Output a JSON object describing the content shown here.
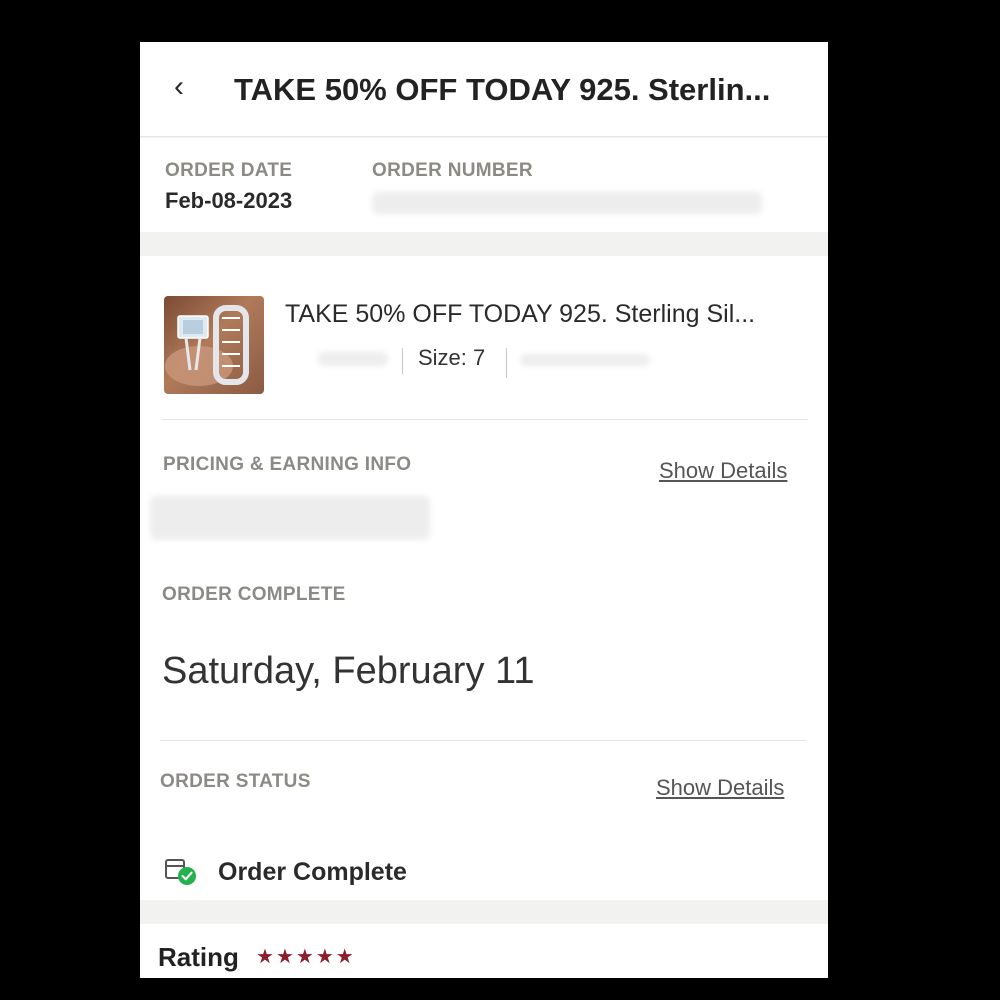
{
  "header": {
    "back_icon": "chevron-left-icon",
    "title": "TAKE 50% OFF TODAY 925. Sterlin..."
  },
  "order_info": {
    "date_label": "ORDER DATE",
    "date_value": "Feb-08-2023",
    "number_label": "ORDER NUMBER"
  },
  "product": {
    "title": "TAKE 50% OFF TODAY 925. Sterling Sil...",
    "size": "Size: 7"
  },
  "pricing": {
    "label": "PRICING & EARNING INFO",
    "link": "Show Details"
  },
  "completion": {
    "label": "ORDER COMPLETE",
    "date": "Saturday, February 11"
  },
  "status": {
    "label": "ORDER STATUS",
    "link": "Show Details",
    "text": "Order Complete",
    "icon": "package-check-icon",
    "check_color": "#22b14c"
  },
  "rating": {
    "label": "Rating",
    "stars": 5,
    "stars_text": "★★★★★",
    "star_color": "#8b1d2c"
  }
}
